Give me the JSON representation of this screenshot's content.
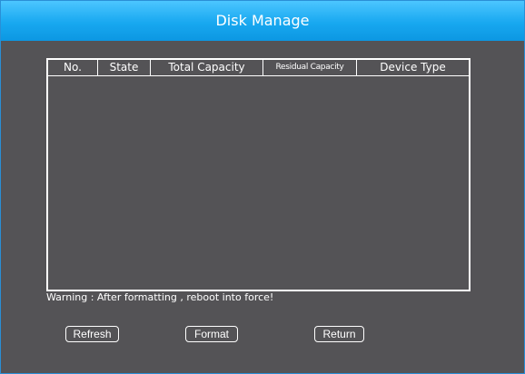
{
  "window": {
    "title": "Disk Manage"
  },
  "table": {
    "columns": [
      "No.",
      "State",
      "Total Capacity",
      "Residual Capacity",
      "Device Type"
    ],
    "rows": []
  },
  "warning": "Warning : After formatting , reboot into force!",
  "buttons": {
    "refresh": "Refresh",
    "format": "Format",
    "return": "Return"
  },
  "colors": {
    "title_bar": "#18a8f0",
    "background": "#545356",
    "text": "#ffffff"
  }
}
